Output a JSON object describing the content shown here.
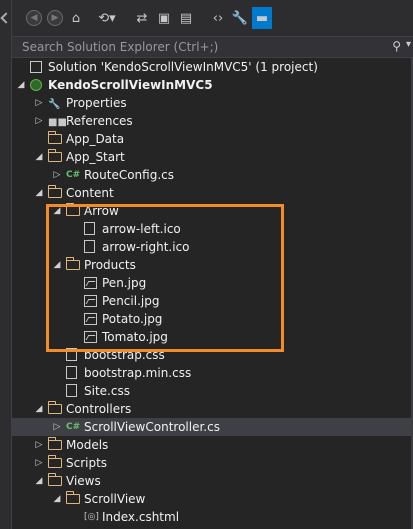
{
  "search": {
    "placeholder": "Search Solution Explorer (Ctrl+;)"
  },
  "toolbar": {
    "icons": [
      "back-icon",
      "forward-icon",
      "home-icon",
      "history-icon",
      "sync-icon",
      "collapse-all-icon",
      "show-all-files-icon",
      "view-code-icon",
      "properties-wrench-icon",
      "preview-pin-icon"
    ]
  },
  "tree": [
    {
      "label": "Solution 'KendoScrollViewInMVC5' (1 project)",
      "depth": 0,
      "icon": "solution-icon",
      "expander": ""
    },
    {
      "label": "KendoScrollViewInMVC5",
      "depth": 0,
      "icon": "web-project-icon",
      "expander": "open",
      "bold": true
    },
    {
      "label": "Properties",
      "depth": 1,
      "icon": "wrench-icon",
      "expander": "closed"
    },
    {
      "label": "References",
      "depth": 1,
      "icon": "references-icon",
      "expander": "closed"
    },
    {
      "label": "App_Data",
      "depth": 1,
      "icon": "folder-icon",
      "expander": ""
    },
    {
      "label": "App_Start",
      "depth": 1,
      "icon": "folder-icon",
      "expander": "open"
    },
    {
      "label": "RouteConfig.cs",
      "depth": 2,
      "icon": "csharp-file-icon",
      "expander": "closed"
    },
    {
      "label": "Content",
      "depth": 1,
      "icon": "folder-icon",
      "expander": "open"
    },
    {
      "label": "Arrow",
      "depth": 2,
      "icon": "folder-icon",
      "expander": "open"
    },
    {
      "label": "arrow-left.ico",
      "depth": 3,
      "icon": "ico-file-icon",
      "expander": ""
    },
    {
      "label": "arrow-right.ico",
      "depth": 3,
      "icon": "ico-file-icon",
      "expander": ""
    },
    {
      "label": "Products",
      "depth": 2,
      "icon": "folder-icon",
      "expander": "open"
    },
    {
      "label": "Pen.jpg",
      "depth": 3,
      "icon": "image-file-icon",
      "expander": ""
    },
    {
      "label": "Pencil.jpg",
      "depth": 3,
      "icon": "image-file-icon",
      "expander": ""
    },
    {
      "label": "Potato.jpg",
      "depth": 3,
      "icon": "image-file-icon",
      "expander": ""
    },
    {
      "label": "Tomato.jpg",
      "depth": 3,
      "icon": "image-file-icon",
      "expander": ""
    },
    {
      "label": "bootstrap.css",
      "depth": 2,
      "icon": "css-file-icon",
      "expander": ""
    },
    {
      "label": "bootstrap.min.css",
      "depth": 2,
      "icon": "css-file-icon",
      "expander": ""
    },
    {
      "label": "Site.css",
      "depth": 2,
      "icon": "css-file-icon",
      "expander": ""
    },
    {
      "label": "Controllers",
      "depth": 1,
      "icon": "folder-icon",
      "expander": "open"
    },
    {
      "label": "ScrollViewController.cs",
      "depth": 2,
      "icon": "csharp-file-icon",
      "expander": "closed",
      "selected": true
    },
    {
      "label": "Models",
      "depth": 1,
      "icon": "folder-icon",
      "expander": "closed"
    },
    {
      "label": "Scripts",
      "depth": 1,
      "icon": "folder-icon",
      "expander": "closed"
    },
    {
      "label": "Views",
      "depth": 1,
      "icon": "folder-icon",
      "expander": "open"
    },
    {
      "label": "ScrollView",
      "depth": 2,
      "icon": "folder-icon",
      "expander": "open"
    },
    {
      "label": "Index.cshtml",
      "depth": 3,
      "icon": "cshtml-file-icon",
      "expander": ""
    }
  ],
  "colors": {
    "background": "#252526",
    "highlight": "#f28c28",
    "selection": "#3f3f46",
    "accent": "#007acc"
  }
}
